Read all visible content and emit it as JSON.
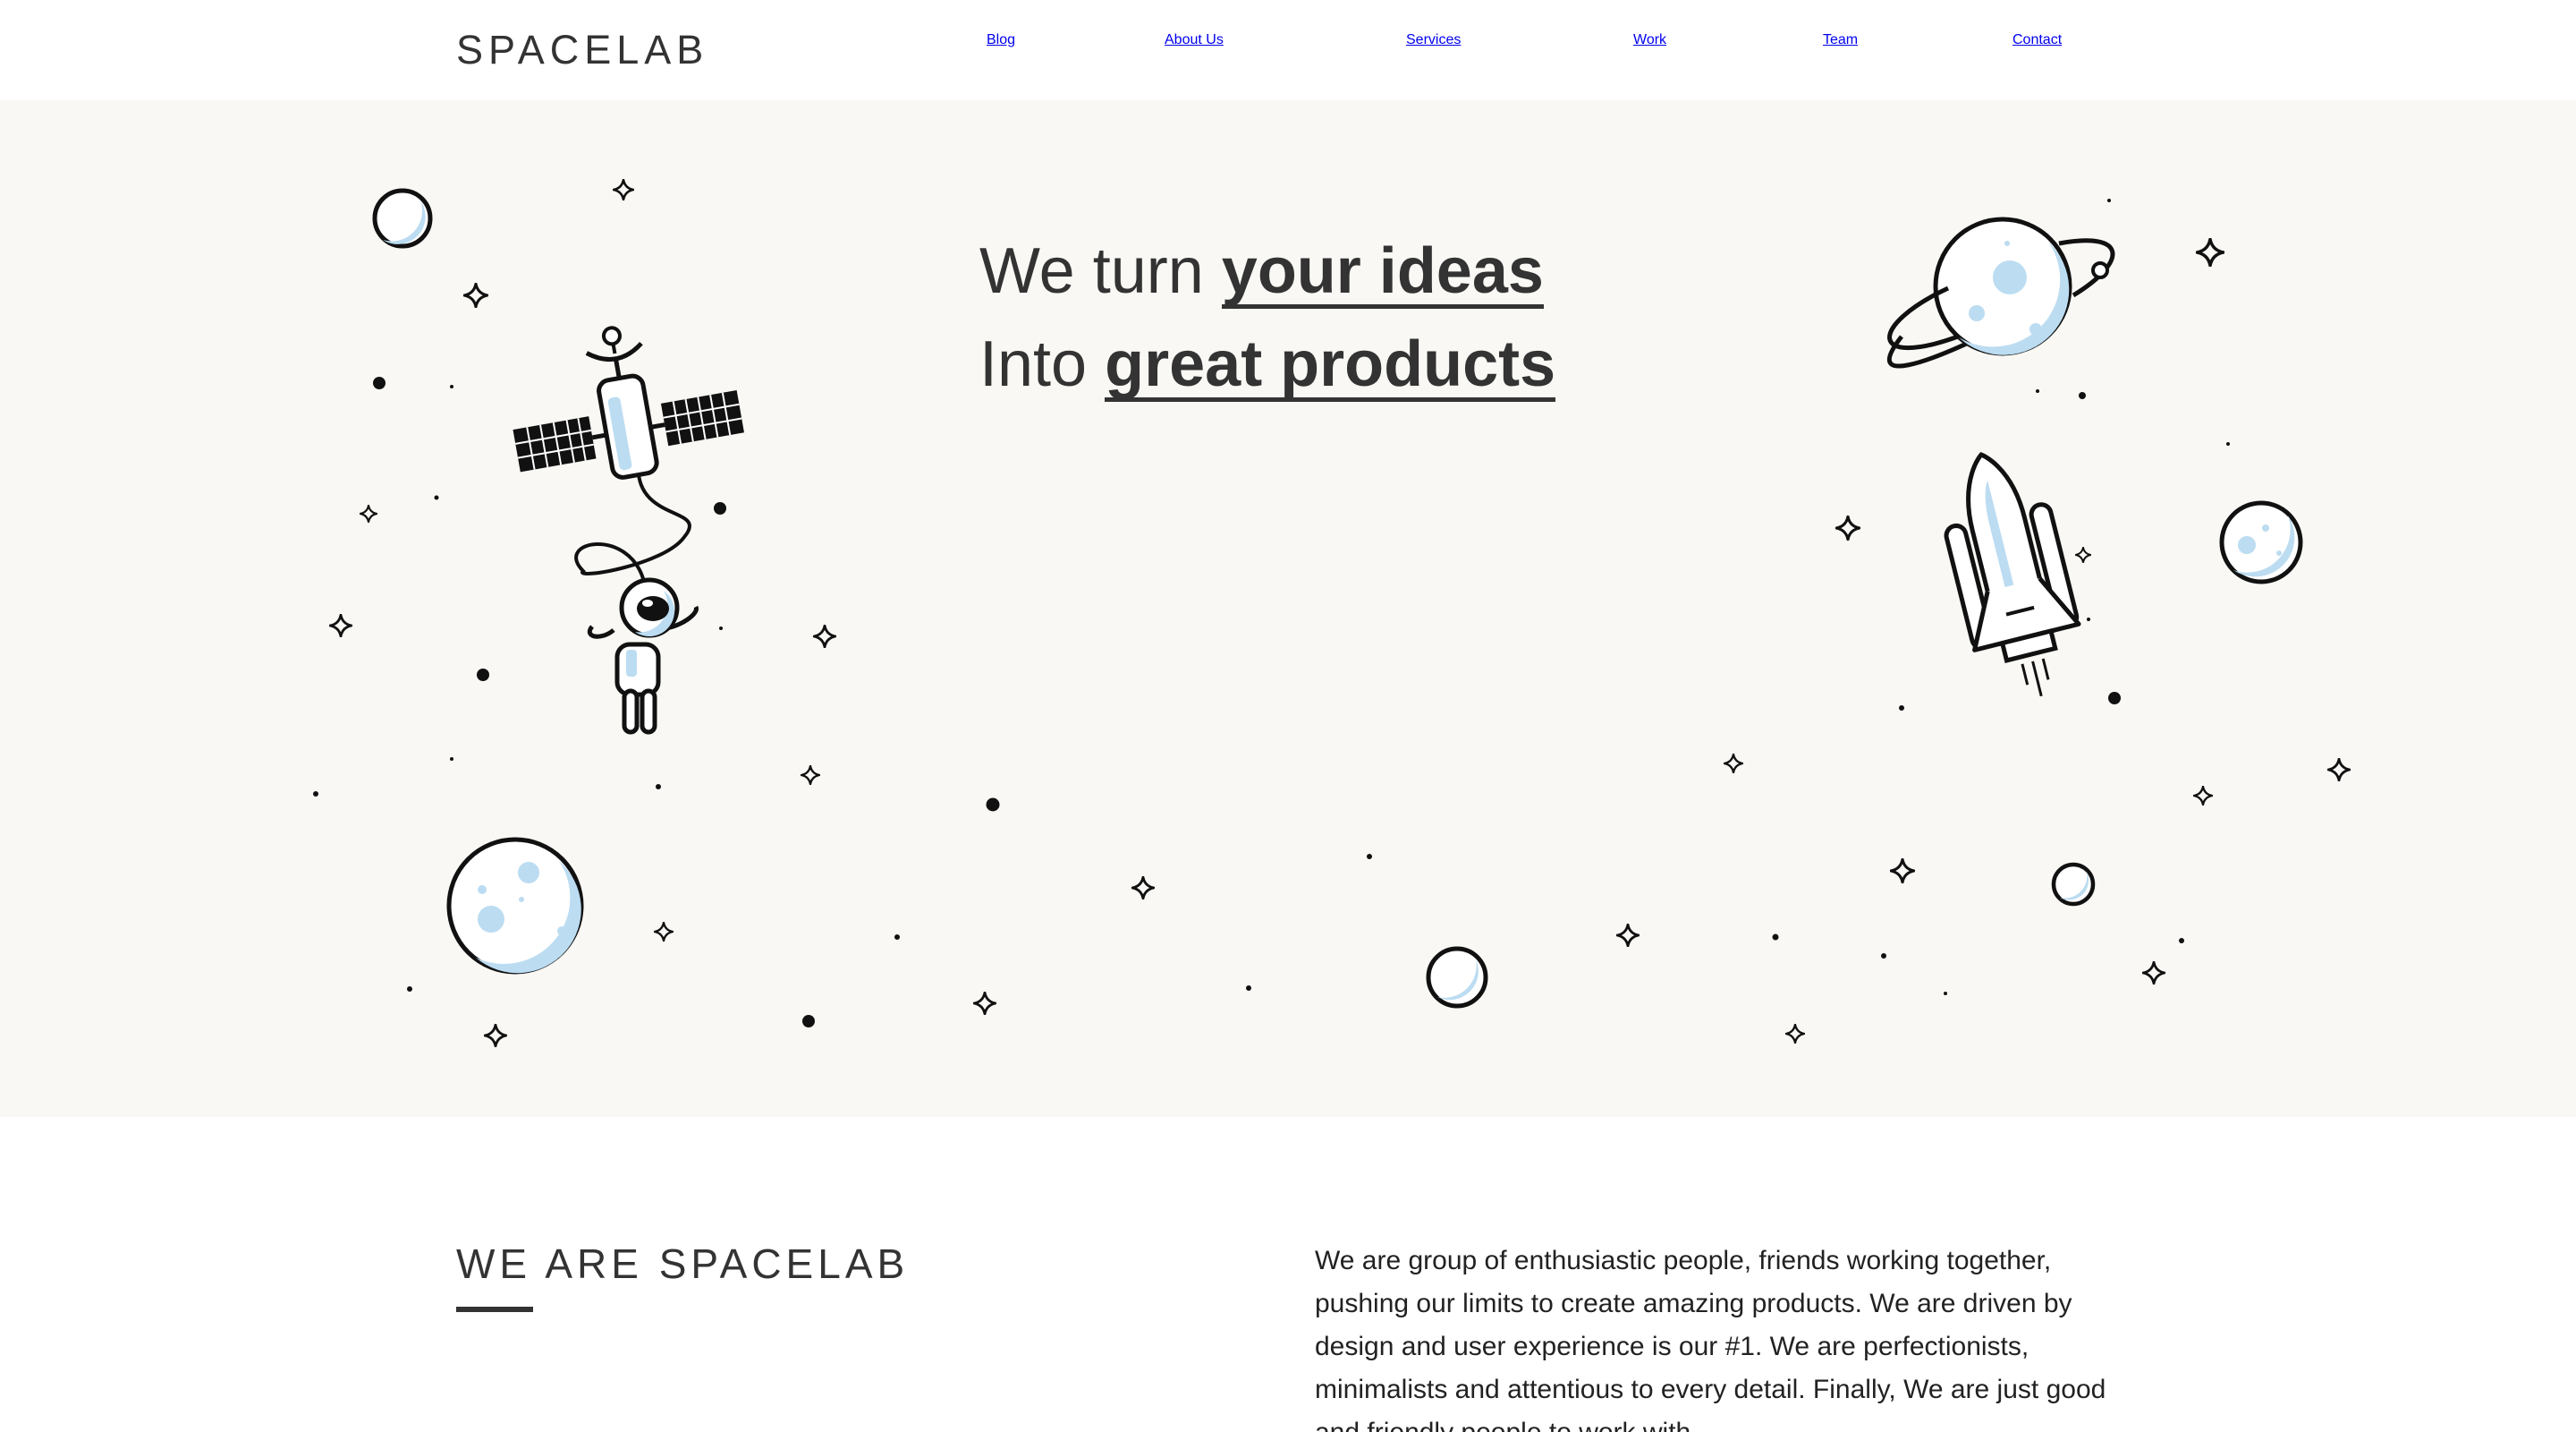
{
  "header": {
    "logo": "SPACELAB",
    "nav": [
      {
        "label": "Blog"
      },
      {
        "label": "About Us"
      },
      {
        "label": "Services"
      },
      {
        "label": "Work"
      },
      {
        "label": "Team"
      },
      {
        "label": "Contact"
      }
    ]
  },
  "hero": {
    "line1_prefix": "We turn ",
    "line1_highlight": "your ideas",
    "line2_prefix": "Into ",
    "line2_highlight": "great products"
  },
  "about": {
    "title": "WE ARE SPACELAB",
    "text": "We are group of enthusiastic people, friends working together, pushing our limits to create amazing products. We are driven by design and user experience is our #1. We are perfectionists, minimalists and attentious to every detail. Finally, We are just good and friendly people to work with."
  },
  "colors": {
    "hero_background": "#f9f8f4",
    "illustration_accent": "#bcdcf1",
    "text": "#333333"
  }
}
